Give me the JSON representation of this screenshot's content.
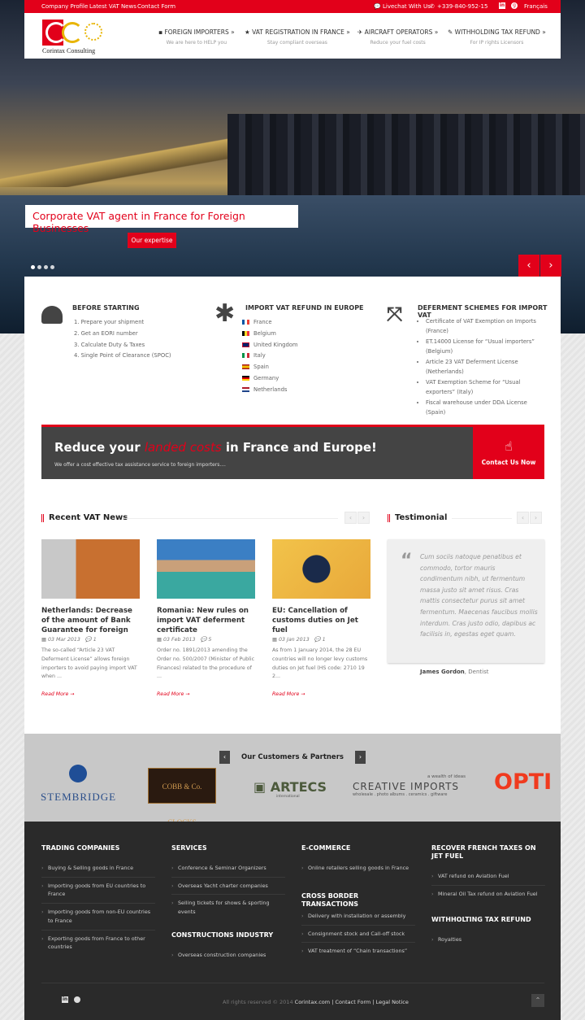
{
  "topbar": {
    "links": [
      "Company Profile",
      "Latest VAT News",
      "Contact Form"
    ],
    "livechat": "Livechat With Us",
    "phone": "+339-840-952-15",
    "language": "Français"
  },
  "header": {
    "logo_text": "Corintax Consulting",
    "nav": [
      {
        "label": "FOREIGN IMPORTERS »",
        "sub": "We are here to HELP you",
        "icon": "briefcase-icon"
      },
      {
        "label": "VAT REGISTRATION IN FRANCE »",
        "sub": "Stay compliant overseas",
        "icon": "star-icon"
      },
      {
        "label": "AIRCRAFT OPERATORS »",
        "sub": "Reduce your fuel costs",
        "icon": "plane-icon"
      },
      {
        "label": "WITHHOLDING TAX REFUND »",
        "sub": "For IP rights Licensors",
        "icon": "pencil-icon"
      }
    ]
  },
  "hero": {
    "caption": "Corporate VAT agent in France for Foreign Businesses",
    "button": "Our expertise",
    "slides": 4,
    "active_slide": 1
  },
  "features": [
    {
      "title": "BEFORE STARTING",
      "icon": "dashboard-icon",
      "items": [
        "1.  Prepare your shipment",
        "2.  Get an EORI number",
        "3.  Calculate Duty & Taxes",
        "4.  Single Point of Clearance (SPOC)"
      ]
    },
    {
      "title": "IMPORT VAT REFUND IN EUROPE",
      "icon": "asterisk-icon",
      "items": [
        "France",
        "Belgium",
        "United Kingdom",
        "Italy",
        "Spain",
        "Germany",
        "Netherlands"
      ]
    },
    {
      "title": "DEFERMENT SCHEMES FOR IMPORT VAT",
      "icon": "expand-icon",
      "items": [
        "Certificate of VAT Exemption on Imports (France)",
        "ET.14000 License for “Usual importers” (Belgium)",
        "Article 23 VAT Deferment License (Netherlands)",
        "VAT Exemption Scheme for “Usual exporters” (Italy)",
        "Fiscal warehouse under DDA License (Spain)"
      ]
    }
  ],
  "banner": {
    "title_pre": "Reduce your ",
    "title_em": "landed costs",
    "title_post": " in France and Europe!",
    "text": "We offer a cost effective tax assistance service to foreign importers....",
    "button": "Contact Us Now"
  },
  "news": {
    "title": "Recent VAT News",
    "items": [
      {
        "title": "Netherlands: Decrease of the amount of Bank Guarantee for foreign",
        "date": "03 Mar 2013",
        "comments": "1",
        "excerpt": "The so-called “Article 23 VAT Deferment License” allows foreign importers to avoid paying import VAT when ...",
        "more": "Read More →"
      },
      {
        "title": "Romania: New rules on import VAT deferment certificate",
        "date": "03 Feb 2013",
        "comments": "5",
        "excerpt": "Order no. 1891/2013 amending the Order no. 500/2007 (Minister of Public Finances) related to the procedure of ...",
        "more": "Read More →"
      },
      {
        "title": "EU: Cancellation of customs duties on Jet fuel",
        "date": "03 Jan 2013",
        "comments": "1",
        "excerpt": "As from 1 January 2014, the 28 EU countries will no longer levy customs duties on Jet fuel (HS code: 2710 19 2...",
        "more": "Read More →"
      }
    ]
  },
  "testimonial": {
    "title": "Testimonial",
    "quote": "Cum sociis natoque penatibus et commodo, tortor mauris condimentum nibh, ut fermentum massa justo sit amet risus. Cras mattis consectetur purus sit amet fermentum. Maecenas faucibus mollis interdum. Cras justo odio, dapibus ac facilisis in, egestas eget quam.",
    "author": "James Gordon",
    "role": ", Dentist"
  },
  "partners": {
    "title": "Our Customers & Partners",
    "logos": [
      "STEMBRIDGE",
      "COBB & Co. CLOCKS",
      "ARTECS",
      "CREATIVE IMPORTS",
      "OPTI"
    ],
    "artecs_sub": "international",
    "creative_tag": "a wealth of ideas",
    "creative_sub": "wholesale . photo albums . ceramics . giftware"
  },
  "footer": {
    "columns": [
      [
        {
          "title": "TRADING COMPANIES",
          "items": [
            "Buying & Selling goods in France",
            "Importing goods from EU countries to France",
            "Importing goods from non-EU countries to France",
            "Exporting goods from France to other countries"
          ]
        }
      ],
      [
        {
          "title": "SERVICES",
          "items": [
            "Conference & Seminar Organizers",
            "Overseas Yacht charter companies",
            "Selling tickets for shows & sporting events"
          ]
        },
        {
          "title": "CONSTRUCTIONS INDUSTRY",
          "items": [
            "Overseas construction companies"
          ]
        }
      ],
      [
        {
          "title": "E-COMMERCE",
          "items": [
            "Online retailers selling goods in France"
          ]
        },
        {
          "title": "CROSS BORDER TRANSACTIONS",
          "items": [
            "Delivery with installation or assembly",
            "Consignment stock and Call-off stock",
            "VAT treatment of “Chain transactions”"
          ]
        }
      ],
      [
        {
          "title": "RECOVER FRENCH TAXES ON JET FUEL",
          "items": [
            "VAT refund on Aviation Fuel",
            "Mineral Oil Tax refund on Aviation Fuel"
          ]
        },
        {
          "title": "WITHHOLTING TAX REFUND",
          "items": [
            "Royalties"
          ]
        }
      ]
    ],
    "copyright": "All rights reserved © 2014",
    "links": [
      "Corintax.com",
      "Contact Form",
      "Legal Notice"
    ]
  },
  "colors": {
    "accent": "#e2001a",
    "dark": "#444444",
    "footer": "#2a2a2a"
  }
}
